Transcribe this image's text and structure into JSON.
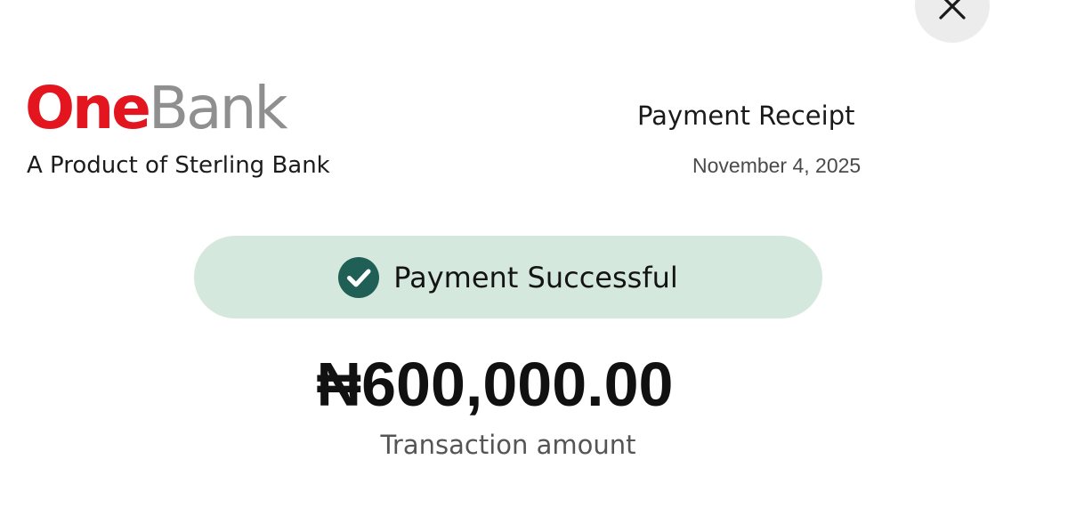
{
  "close_button": {
    "icon": "close-icon"
  },
  "brand": {
    "name_part1": "One",
    "name_part2": "Bank",
    "tagline": "A Product of Sterling Bank",
    "primary_color": "#e3161f",
    "secondary_color": "#8f8f8f"
  },
  "receipt": {
    "title": "Payment Receipt",
    "date": "November 4, 2025"
  },
  "status": {
    "icon": "check-circle-icon",
    "label": "Payment Successful",
    "pill_color": "#d5e8de",
    "icon_color": "#1f5f56"
  },
  "transaction": {
    "amount": "₦600,000.00",
    "label": "Transaction amount"
  }
}
